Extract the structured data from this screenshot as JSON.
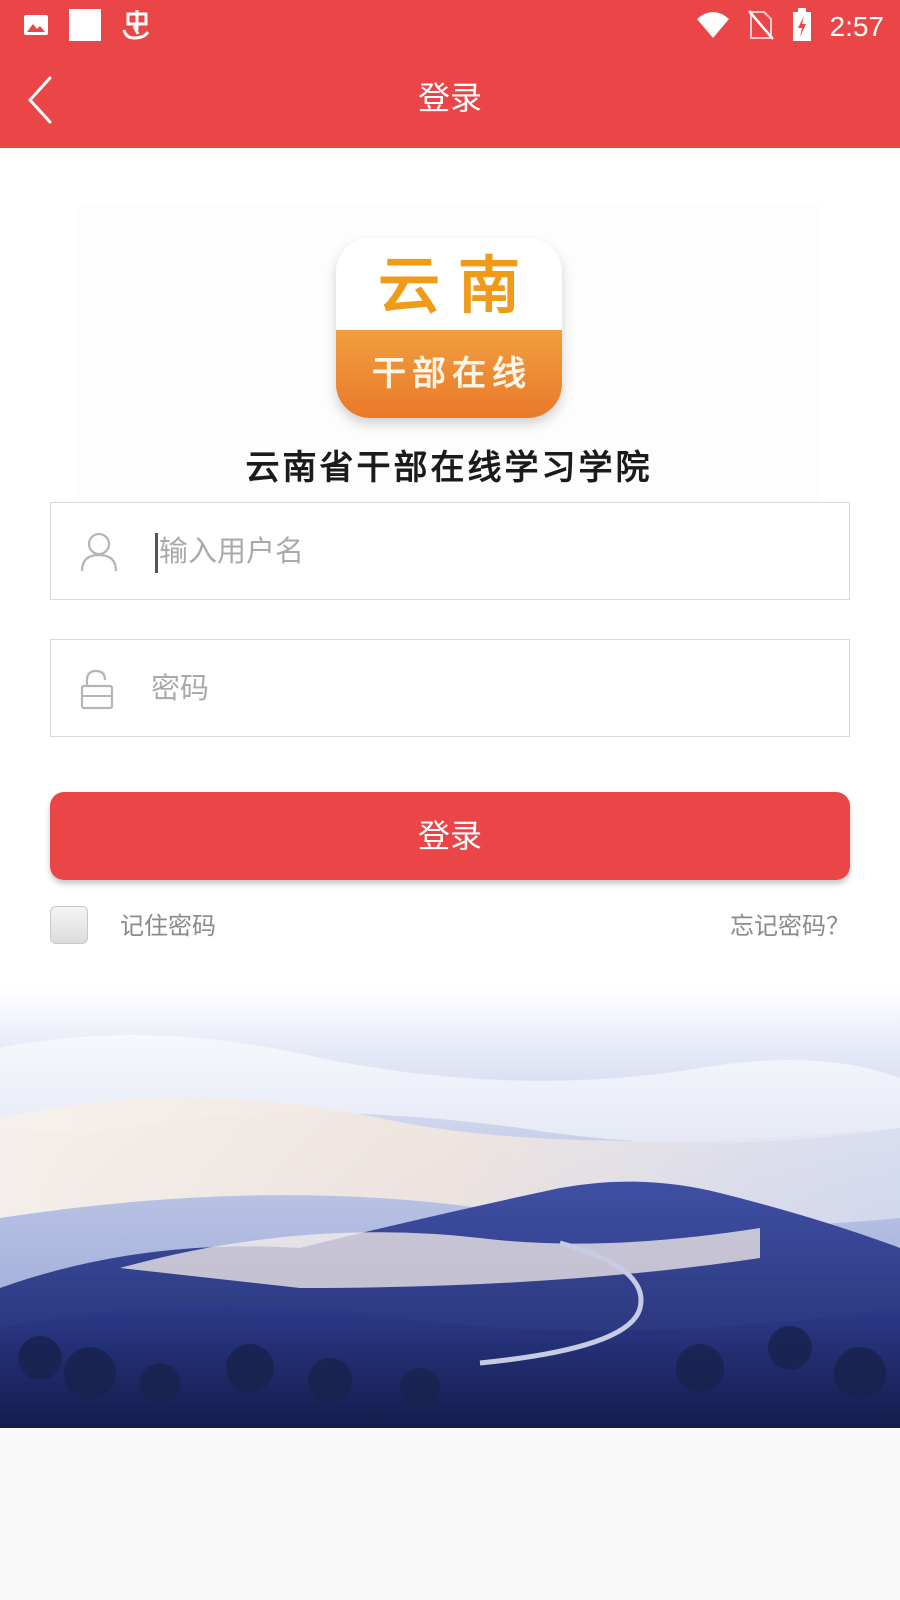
{
  "status_bar": {
    "time": "2:57",
    "left_icons": [
      "image-icon",
      "square-icon",
      "bug-icon"
    ],
    "right_icons": [
      "wifi-icon",
      "no-sim-icon",
      "battery-charging-icon"
    ]
  },
  "header": {
    "title": "登录",
    "back_icon": "chevron-left-icon"
  },
  "logo": {
    "top_text": "云南",
    "bottom_text": "干部在线",
    "org_name": "云南省干部在线学习学院"
  },
  "form": {
    "username_placeholder": "输入用户名",
    "username_icon": "user-icon",
    "password_placeholder": "密码",
    "password_icon": "unlock-icon",
    "login_label": "登录",
    "remember_label": "记住密码",
    "remember_checked": false,
    "forgot_label": "忘记密码？"
  },
  "colors": {
    "brand_red": "#ea4648",
    "logo_orange": "#f09a1a",
    "muted_text": "#8a8a8a"
  }
}
